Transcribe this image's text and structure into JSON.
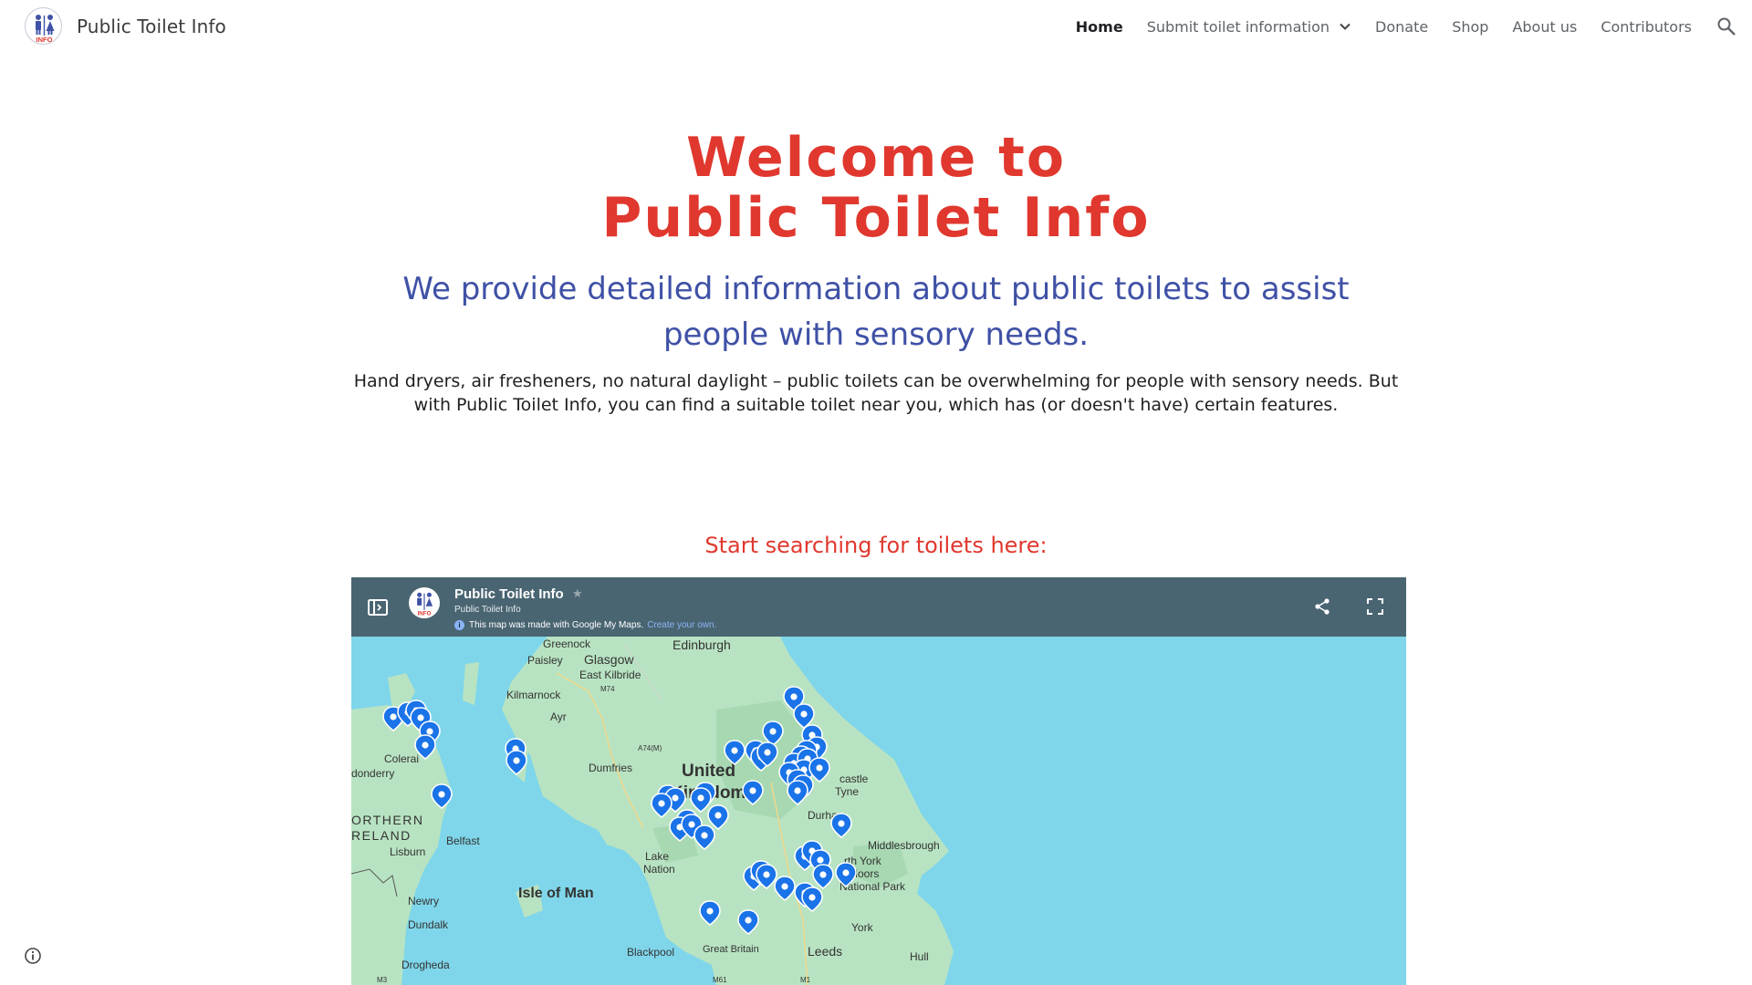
{
  "header": {
    "site_title": "Public Toilet Info",
    "logo_text": "INFO",
    "nav": [
      {
        "label": "Home",
        "active": true
      },
      {
        "label": "Submit toilet information",
        "has_dropdown": true
      },
      {
        "label": "Donate"
      },
      {
        "label": "Shop"
      },
      {
        "label": "About us"
      },
      {
        "label": "Contributors"
      }
    ],
    "search_icon": "search-icon"
  },
  "hero": {
    "title_line1": "Welcome to",
    "title_line2": "Public Toilet Info",
    "subtitle": "We provide detailed information about public toilets to assist people with sensory needs.",
    "description": "Hand dryers, air fresheners, no natural daylight – public toilets can be overwhelming for people with sensory needs. But with Public Toilet Info, you can find a suitable toilet near you, which has (or doesn't have) certain features.",
    "cta": "Start searching for toilets here:"
  },
  "map": {
    "title": "Public Toilet Info",
    "owner": "Public Toilet Info",
    "notice": "This map was made with Google My Maps.",
    "create_link": "Create your own.",
    "colors": {
      "bar": "#4a6572",
      "sea": "#7fd6ea",
      "land": "#b8e3c2",
      "marker": "#1a73e8"
    },
    "place_labels": {
      "greenock": "Greenock",
      "edinburgh": "Edinburgh",
      "paisley": "Paisley",
      "glasgow": "Glasgow",
      "east_kilbride": "East Kilbride",
      "m74": "M74",
      "kilmarnock": "Kilmarnock",
      "ayr": "Ayr",
      "a74m": "A74(M)",
      "coleraine": "Colerai",
      "londonderry": "donderry",
      "dumfries": "Dumfries",
      "united": "United",
      "kingdom": "Kingdom",
      "newcastle": "castle",
      "tyne": "Tyne",
      "northern": "ORTHERN",
      "ireland": "RELAND",
      "belfast": "Belfast",
      "durham": "Durham",
      "lisburn": "Lisburn",
      "middlesbrough": "Middlesbrough",
      "lake_district": "Lake",
      "national": "Nation",
      "north_york": "rth York",
      "moors": "Moors",
      "national_park": "National Park",
      "isle_of_man": "Isle of Man",
      "newry": "Newry",
      "dundalk": "Dundalk",
      "york": "York",
      "blackpool": "Blackpool",
      "great_britain": "Great Britain",
      "leeds": "Leeds",
      "hull": "Hull",
      "drogheda": "Drogheda",
      "m61": "M61",
      "m1": "M1",
      "m3": "M3"
    }
  }
}
